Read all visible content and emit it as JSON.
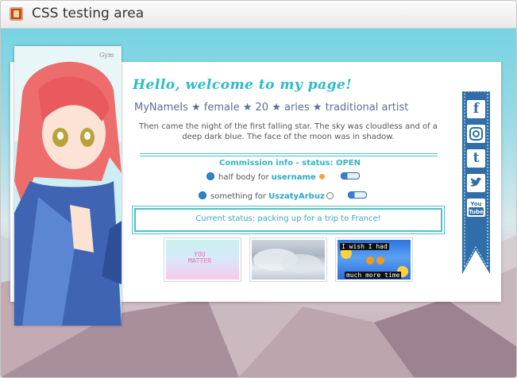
{
  "window": {
    "title": "CSS testing area"
  },
  "colors": {
    "accent": "#4cc2c9",
    "ribbon": "#2f6ea8",
    "username": "#2aa9c4"
  },
  "profile": {
    "welcome": "Hello, welcome to my page!",
    "subtitle": "MyNameIs ★ female ★ 20 ★ aries ★ traditional artist",
    "bio": "Then came the night of the first falling star. The sky was cloudless and of a deep dark blue. The face of the moon was in shadow."
  },
  "commission": {
    "header": "Commission info - status: OPEN",
    "items": [
      {
        "text": "half body for ",
        "user": "username"
      },
      {
        "text": "something for ",
        "user": "UszatyArbuz"
      }
    ]
  },
  "status": {
    "text": "Current status: packing up for a trip to France!"
  },
  "stamps": {
    "you_matter_1": "YOU",
    "you_matter_2": "MATTER",
    "wish_top": "I wish I had",
    "wish_bottom": "much more time"
  },
  "social": {
    "icons": [
      "facebook-icon",
      "instagram-icon",
      "tumblr-icon",
      "twitter-icon",
      "youtube-icon"
    ],
    "glyphs": [
      "f",
      "◎",
      "t",
      "🐦",
      "You\nTube"
    ]
  }
}
